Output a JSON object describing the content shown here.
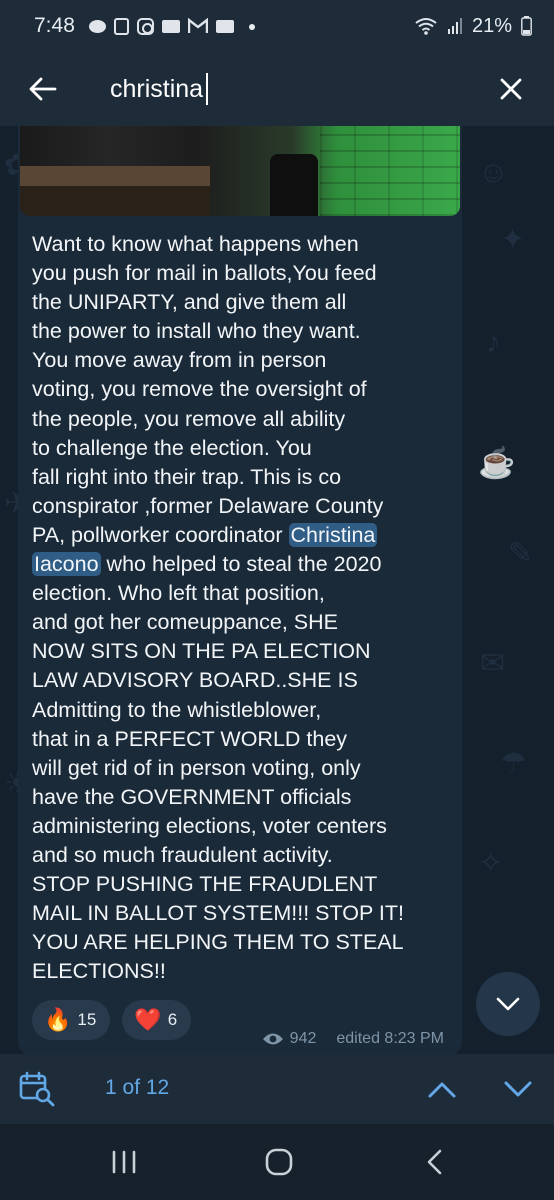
{
  "status_bar": {
    "time": "7:48",
    "battery": "21%",
    "icons": [
      "notification-icon",
      "calendar-icon",
      "instagram-icon",
      "mail-icon",
      "gmail-icon",
      "mail-icon",
      "dot-icon",
      "wifi-icon",
      "signal-icon",
      "battery-icon"
    ]
  },
  "search": {
    "query": "christina",
    "back_icon": "arrow-left-icon",
    "close_icon": "close-icon"
  },
  "message": {
    "text_before": "Want to know what happens when\nyou push for mail in ballots,You feed\nthe UNIPARTY, and give them all\nthe power to install who they want.\nYou move away from in person\nvoting, you remove the oversight of\nthe people, you remove all ability\nto challenge the election. You\nfall right into their trap. This is co\nconspirator ,former Delaware County\nPA, pollworker coordinator ",
    "highlight_1": "Christina",
    "highlight_2": "Iacono",
    "text_after": " who helped to steal the 2020\nelection. Who left that position,\nand got her comeuppance, SHE\nNOW SITS ON THE PA ELECTION\nLAW ADVISORY BOARD..SHE IS\nAdmitting to the whistleblower,\nthat in a PERFECT WORLD they\nwill get rid of in person voting, only\nhave the GOVERNMENT officials\nadministering elections, voter centers\nand so much fraudulent activity.\nSTOP PUSHING THE FRAUDLENT\nMAIL IN BALLOT SYSTEM!!! STOP IT!\nYOU ARE HELPING THEM TO STEAL\nELECTIONS!!",
    "reactions": [
      {
        "emoji": "🔥",
        "count": "15"
      },
      {
        "emoji": "❤️",
        "count": "6"
      }
    ],
    "views": "942",
    "edited": "edited 8:23 PM"
  },
  "toolbar": {
    "result_count": "1 of 12"
  },
  "colors": {
    "accent": "#62a7e6",
    "highlight": "#2f5d86",
    "bubble": "#1b2a38",
    "header": "#1e2c3a"
  }
}
